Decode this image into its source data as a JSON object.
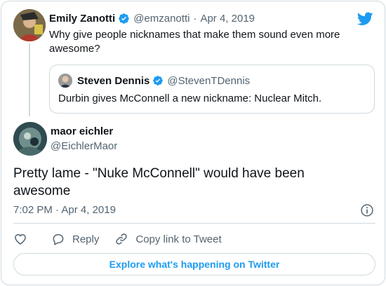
{
  "parent_tweet": {
    "author_name": "Emily Zanotti",
    "author_handle": "@emzanotti",
    "separator": "·",
    "date": "Apr 4, 2019",
    "text": "Why give people nicknames that make them sound even more awesome?"
  },
  "quoted_tweet": {
    "author_name": "Steven Dennis",
    "author_handle": "@StevenTDennis",
    "text": "Durbin gives McConnell a new nickname: Nuclear Mitch."
  },
  "main_tweet": {
    "author_name": "maor eichler",
    "author_handle": "@EichlerMaor",
    "text": "Pretty lame - \"Nuke McConnell\" would have been awesome",
    "time": "7:02 PM",
    "separator": "·",
    "date": "Apr 4, 2019"
  },
  "actions": {
    "reply_label": "Reply",
    "copy_link_label": "Copy link to Tweet"
  },
  "footer": {
    "explore_label": "Explore what's happening on Twitter"
  },
  "icons": {
    "twitter_logo": "twitter-bird-icon",
    "verified": "verified-badge-icon",
    "info": "info-icon",
    "like": "heart-icon",
    "reply": "speech-bubble-icon",
    "copy_link": "link-icon"
  },
  "colors": {
    "brand_blue": "#1d9bf0",
    "text_primary": "#0f1419",
    "text_muted": "#536471",
    "border": "#cfd9de"
  }
}
